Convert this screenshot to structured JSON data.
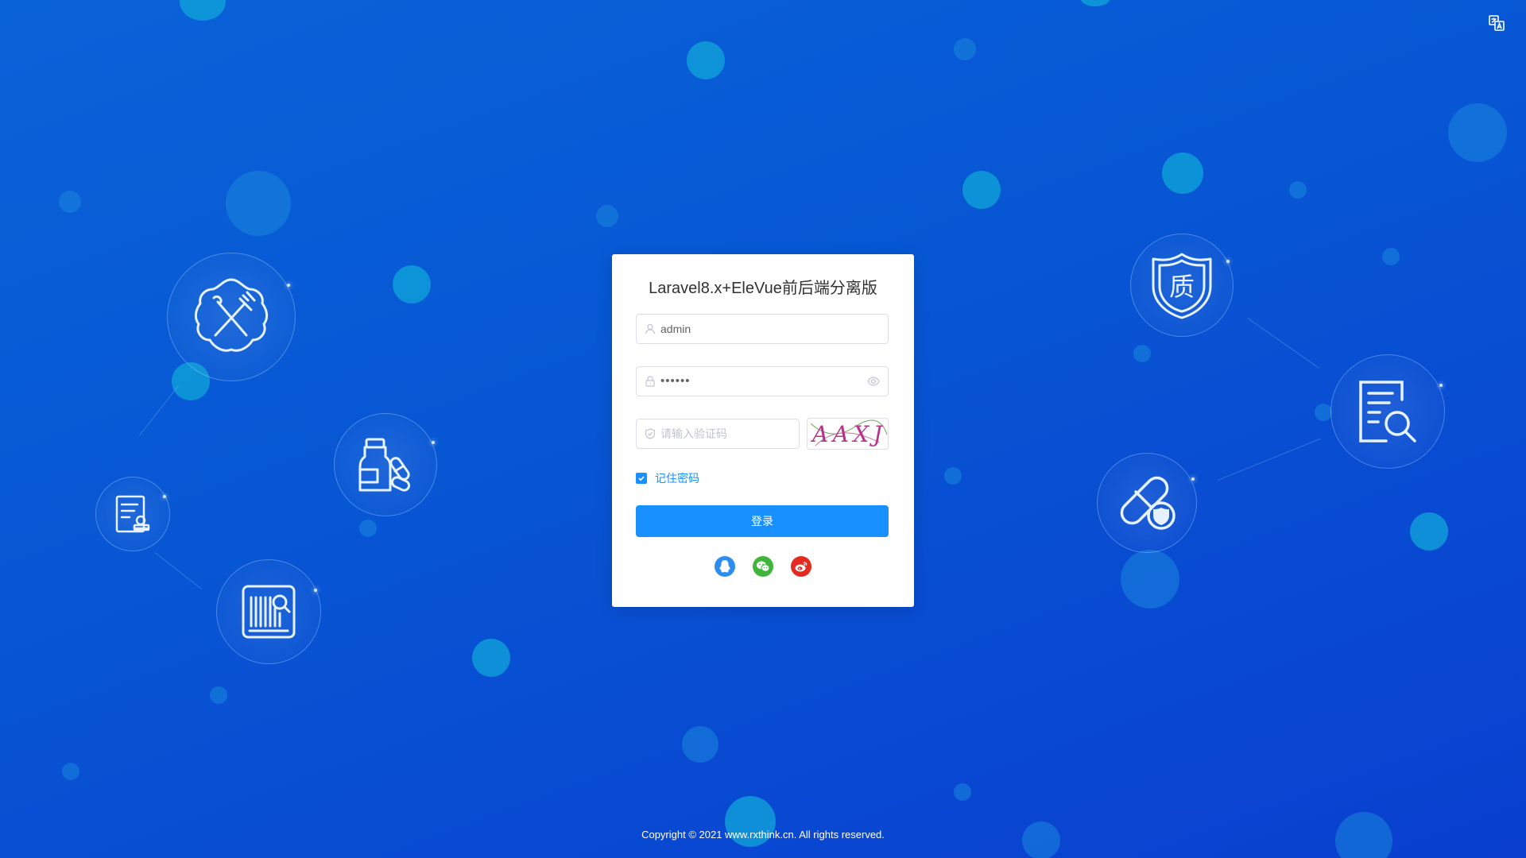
{
  "login": {
    "title": "Laravel8.x+EleVue前后端分离版",
    "username_value": "admin",
    "password_value": "••••••",
    "captcha_placeholder": "请输入验证码",
    "captcha_text": "AAXJ",
    "remember_label": "记住密码",
    "remember_checked": true,
    "submit_label": "登录"
  },
  "socials": [
    "qq-icon",
    "wechat-icon",
    "weibo-icon"
  ],
  "footer": {
    "copyright": "Copyright © 2021 www.rxthink.cn. All rights reserved."
  },
  "colors": {
    "primary": "#1890ff",
    "qq": "#2d8cf0",
    "wechat": "#3fb63a",
    "weibo": "#e52b1f",
    "bubble": "#0fa3d8"
  },
  "icons": [
    "language-translate-icon",
    "food-safety-icon",
    "medicine-icon",
    "certificate-icon",
    "barcode-search-icon",
    "quality-shield-icon",
    "document-search-icon",
    "capsule-shield-icon"
  ],
  "illustration_text": {
    "quality_char": "质"
  }
}
